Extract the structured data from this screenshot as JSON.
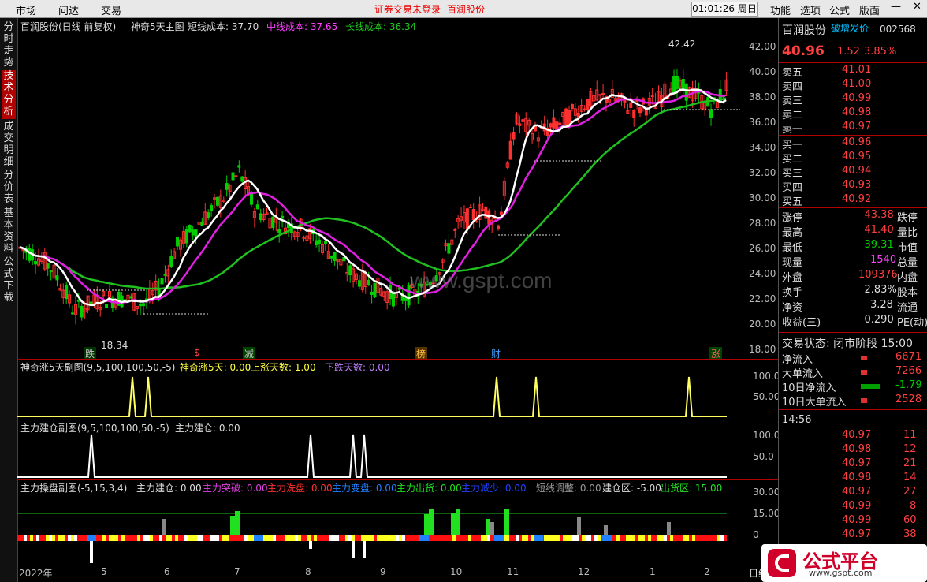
{
  "top_menu": [
    "市场",
    "问达",
    "交易"
  ],
  "status_notice": "证券交易未登录",
  "status_stock": "百润股份",
  "clock": "01:01:26 周日",
  "right_menu": [
    "功能",
    "选项",
    "公式",
    "版面"
  ],
  "left_nav": [
    "分时走势",
    "技术分析",
    "成交明细",
    "分价表",
    "基本资料",
    "公式下载"
  ],
  "main_panel": {
    "title": "百润股份(日线 前复权)",
    "indicator": "神奇5天主图",
    "short_cost": "短线成本: 37.70",
    "mid_cost": "中线成本: 37.65",
    "long_cost": "长线成本: 36.34",
    "high_label": "42.42",
    "low_label": "18.34",
    "y_ticks": [
      "42.00",
      "40.00",
      "38.00",
      "36.00",
      "34.00",
      "32.00",
      "30.00",
      "28.00",
      "26.00",
      "24.00",
      "22.00",
      "20.00",
      "18.00"
    ],
    "markers": [
      {
        "text": "跌",
        "color": "#00d000"
      },
      {
        "text": "$",
        "color": "#ff4040"
      },
      {
        "text": "减",
        "color": "#00d000"
      },
      {
        "text": "榜",
        "color": "#ffa000"
      },
      {
        "text": "财",
        "color": "#00a0ff"
      },
      {
        "text": "涨",
        "color": "#ff4040"
      }
    ]
  },
  "sub1": {
    "title": "神奇涨5天副图(9,5,100,100,50,-5)",
    "v1": "神奇涨5天: 0.00",
    "v2": "上涨天数: 1.00",
    "v3": "下跌天数: 0.00",
    "y_ticks": [
      "100.0",
      "50.00"
    ]
  },
  "sub2": {
    "title": "主力建仓副图(9,5,100,100,50,-5)",
    "v1": "主力建仓: 0.00",
    "y_ticks": [
      "100.0",
      "50.0"
    ]
  },
  "sub3": {
    "title": "主力操盘副图(-5,15,3,4)",
    "v1": "主力建仓: 0.00",
    "v2": "主力突破: 0.00",
    "v3": "主力洗盘: 0.00",
    "v4": "主力变盘: 0.00",
    "v5": "主力出货: 0.00",
    "v6": "主力减少: 0.00",
    "v7": "短线调整: 0.00",
    "v8": "建仓区: -5.00",
    "v9": "出货区: 15.00",
    "y_ticks": [
      "30.00",
      "15.00",
      "0"
    ]
  },
  "x_axis": [
    "2022年",
    "5",
    "6",
    "7",
    "8",
    "9",
    "10",
    "11",
    "12",
    "1",
    "2"
  ],
  "quote": {
    "name": "百润股份",
    "tag": "破增发价",
    "code": "002568",
    "price": "40.96",
    "change": "1.52",
    "pct": "3.85%",
    "asks": [
      {
        "label": "卖五",
        "price": "41.01"
      },
      {
        "label": "卖四",
        "price": "41.00"
      },
      {
        "label": "卖三",
        "price": "40.99"
      },
      {
        "label": "卖二",
        "price": "40.98"
      },
      {
        "label": "卖一",
        "price": "40.97"
      }
    ],
    "bids": [
      {
        "label": "买一",
        "price": "40.96"
      },
      {
        "label": "买二",
        "price": "40.95"
      },
      {
        "label": "买三",
        "price": "40.94"
      },
      {
        "label": "买四",
        "price": "40.93"
      },
      {
        "label": "买五",
        "price": "40.92"
      }
    ],
    "stats": [
      {
        "l": "涨停",
        "v": "43.38",
        "r": "跌停"
      },
      {
        "l": "最高",
        "v": "41.40",
        "r": "量比"
      },
      {
        "l": "最低",
        "v": "39.31",
        "r": "市值"
      },
      {
        "l": "现量",
        "v": "1540",
        "r": "总量"
      },
      {
        "l": "外盘",
        "v": "109376",
        "r": "内盘"
      },
      {
        "l": "换手",
        "v": "2.83%",
        "r": "股本"
      },
      {
        "l": "净资",
        "v": "3.28",
        "r": "流通"
      },
      {
        "l": "收益(三)",
        "v": "0.290",
        "r": "PE(动)"
      }
    ],
    "trade_status": "交易状态: 闭市阶段 15:00",
    "flows": [
      {
        "l": "净流入",
        "v": "6671"
      },
      {
        "l": "大单流入",
        "v": "7266"
      },
      {
        "l": "10日净流入",
        "v": "-1.79"
      },
      {
        "l": "10日大单流入",
        "v": "2528"
      }
    ],
    "ticks_time": "14:56",
    "ticks": [
      {
        "p": "40.97",
        "v": "11"
      },
      {
        "p": "40.98",
        "v": "12"
      },
      {
        "p": "40.97",
        "v": "21"
      },
      {
        "p": "40.98",
        "v": "14"
      },
      {
        "p": "40.97",
        "v": "27"
      },
      {
        "p": "40.99",
        "v": "8"
      },
      {
        "p": "40.99",
        "v": "60"
      },
      {
        "p": "40.97",
        "v": "38"
      }
    ],
    "side_tab": "日线"
  },
  "watermark": "www.gspt.com",
  "logo": {
    "name": "公式平台",
    "url": "www.gspt.com"
  },
  "colors": {
    "up": "#ff4040",
    "down": "#00d000",
    "ma_short": "#ffffff",
    "ma_mid": "#e020e0",
    "ma_long": "#20c020",
    "accent": "#ffff00"
  }
}
